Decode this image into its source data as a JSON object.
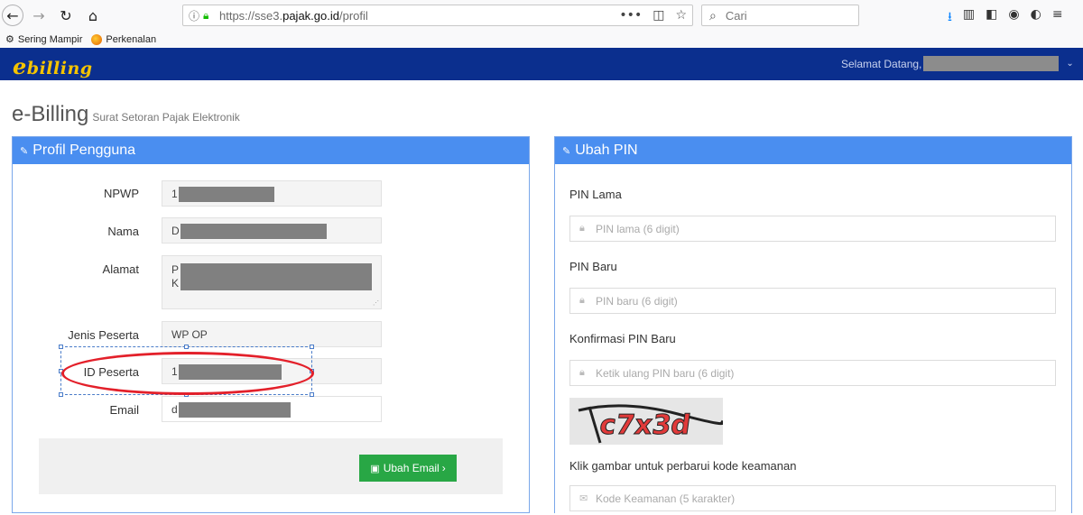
{
  "browser": {
    "url_prefix": "https://sse3.",
    "url_domain": "pajak.go.id",
    "url_path": "/profil",
    "search_placeholder": "Cari",
    "bookmarks": [
      "Sering Mampir",
      "Perkenalan"
    ]
  },
  "header": {
    "logo": "billing",
    "logo_e": "e",
    "welcome": "Selamat Datang,"
  },
  "page": {
    "title": "e-Billing",
    "subtitle": "Surat Setoran Pajak Elektronik"
  },
  "profile": {
    "heading": "Profil Pengguna",
    "fields": [
      {
        "label": "NPWP",
        "value": "1"
      },
      {
        "label": "Nama",
        "value": "D"
      },
      {
        "label": "Alamat",
        "value_line1": "P",
        "value_line2": "K"
      },
      {
        "label": "Jenis Peserta",
        "value": "WP OP"
      },
      {
        "label": "ID Peserta",
        "value": "1"
      },
      {
        "label": "Email",
        "value": "d"
      }
    ],
    "email_button": "Ubah Email"
  },
  "pin": {
    "heading": "Ubah PIN",
    "old_label": "PIN Lama",
    "old_placeholder": "PIN lama (6 digit)",
    "new_label": "PIN Baru",
    "new_placeholder": "PIN baru (6 digit)",
    "confirm_label": "Konfirmasi PIN Baru",
    "confirm_placeholder": "Ketik ulang PIN baru (6 digit)",
    "captcha_text": "c7x3d",
    "captcha_hint": "Klik gambar untuk perbarui kode keamanan",
    "captcha_placeholder": "Kode Keamanan (5 karakter)"
  },
  "colors": {
    "header_bg": "#0b2f8e",
    "logo": "#f5c400",
    "panel_head": "#4a8ef0",
    "button_green": "#28a745",
    "annotation_red": "#e3202a"
  }
}
